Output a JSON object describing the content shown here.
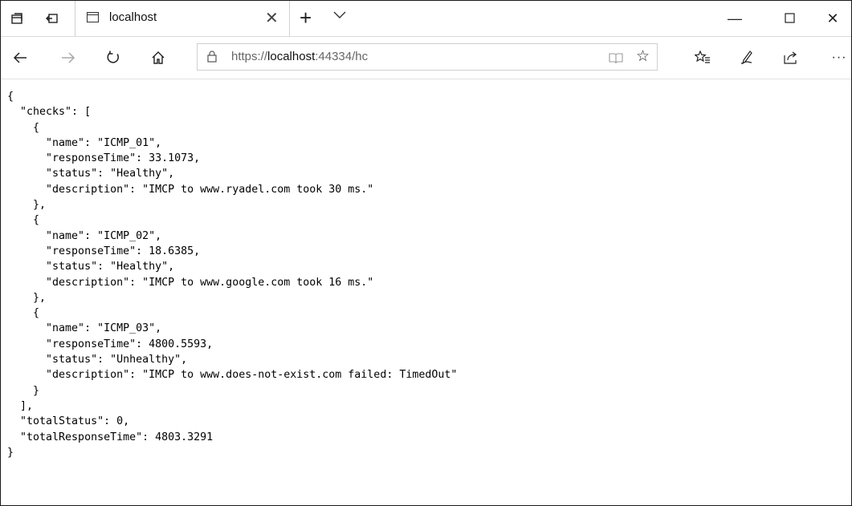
{
  "tab": {
    "title": "localhost"
  },
  "address_bar": {
    "url_prefix": "https://",
    "url_host": "localhost",
    "url_rest": ":44334/hc"
  },
  "icons": {
    "set_aside": "tabs-aside-icon",
    "restore": "restore-tabs-icon",
    "back": "back-arrow-icon",
    "forward": "forward-arrow-icon",
    "refresh": "refresh-icon",
    "home": "home-icon",
    "lock": "lock-icon",
    "reading": "reading-view-icon",
    "favorite": "favorite-star-icon",
    "favorites_hub": "favorites-hub-icon",
    "notes": "web-note-icon",
    "share": "share-icon",
    "more": "more-icon"
  },
  "json_text": "{\n  \"checks\": [\n    {\n      \"name\": \"ICMP_01\",\n      \"responseTime\": 33.1073,\n      \"status\": \"Healthy\",\n      \"description\": \"IMCP to www.ryadel.com took 30 ms.\"\n    },\n    {\n      \"name\": \"ICMP_02\",\n      \"responseTime\": 18.6385,\n      \"status\": \"Healthy\",\n      \"description\": \"IMCP to www.google.com took 16 ms.\"\n    },\n    {\n      \"name\": \"ICMP_03\",\n      \"responseTime\": 4800.5593,\n      \"status\": \"Unhealthy\",\n      \"description\": \"IMCP to www.does-not-exist.com failed: TimedOut\"\n    }\n  ],\n  \"totalStatus\": 0,\n  \"totalResponseTime\": 4803.3291\n}"
}
